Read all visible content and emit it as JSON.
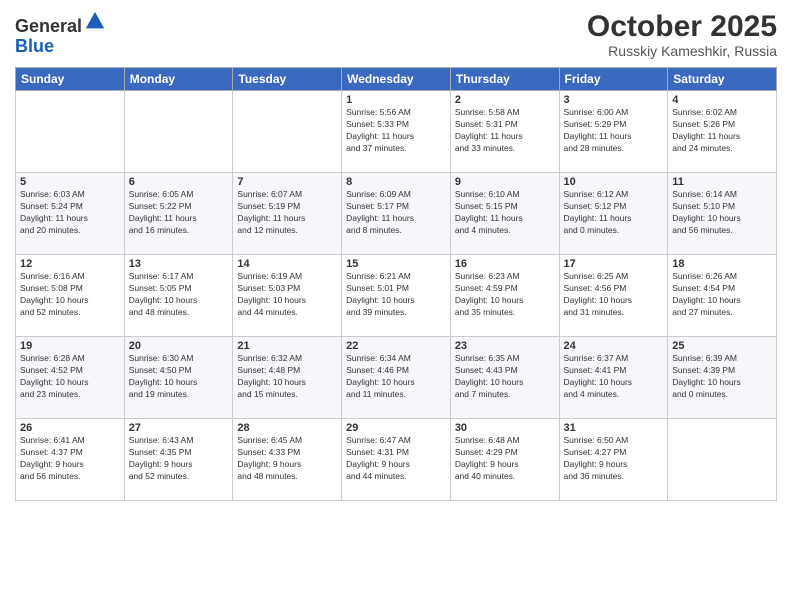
{
  "header": {
    "logo_general": "General",
    "logo_blue": "Blue",
    "month": "October 2025",
    "location": "Russkiy Kameshkir, Russia"
  },
  "weekdays": [
    "Sunday",
    "Monday",
    "Tuesday",
    "Wednesday",
    "Thursday",
    "Friday",
    "Saturday"
  ],
  "weeks": [
    [
      {
        "day": "",
        "info": ""
      },
      {
        "day": "",
        "info": ""
      },
      {
        "day": "",
        "info": ""
      },
      {
        "day": "1",
        "info": "Sunrise: 5:56 AM\nSunset: 5:33 PM\nDaylight: 11 hours\nand 37 minutes."
      },
      {
        "day": "2",
        "info": "Sunrise: 5:58 AM\nSunset: 5:31 PM\nDaylight: 11 hours\nand 33 minutes."
      },
      {
        "day": "3",
        "info": "Sunrise: 6:00 AM\nSunset: 5:29 PM\nDaylight: 11 hours\nand 28 minutes."
      },
      {
        "day": "4",
        "info": "Sunrise: 6:02 AM\nSunset: 5:26 PM\nDaylight: 11 hours\nand 24 minutes."
      }
    ],
    [
      {
        "day": "5",
        "info": "Sunrise: 6:03 AM\nSunset: 5:24 PM\nDaylight: 11 hours\nand 20 minutes."
      },
      {
        "day": "6",
        "info": "Sunrise: 6:05 AM\nSunset: 5:22 PM\nDaylight: 11 hours\nand 16 minutes."
      },
      {
        "day": "7",
        "info": "Sunrise: 6:07 AM\nSunset: 5:19 PM\nDaylight: 11 hours\nand 12 minutes."
      },
      {
        "day": "8",
        "info": "Sunrise: 6:09 AM\nSunset: 5:17 PM\nDaylight: 11 hours\nand 8 minutes."
      },
      {
        "day": "9",
        "info": "Sunrise: 6:10 AM\nSunset: 5:15 PM\nDaylight: 11 hours\nand 4 minutes."
      },
      {
        "day": "10",
        "info": "Sunrise: 6:12 AM\nSunset: 5:12 PM\nDaylight: 11 hours\nand 0 minutes."
      },
      {
        "day": "11",
        "info": "Sunrise: 6:14 AM\nSunset: 5:10 PM\nDaylight: 10 hours\nand 56 minutes."
      }
    ],
    [
      {
        "day": "12",
        "info": "Sunrise: 6:16 AM\nSunset: 5:08 PM\nDaylight: 10 hours\nand 52 minutes."
      },
      {
        "day": "13",
        "info": "Sunrise: 6:17 AM\nSunset: 5:05 PM\nDaylight: 10 hours\nand 48 minutes."
      },
      {
        "day": "14",
        "info": "Sunrise: 6:19 AM\nSunset: 5:03 PM\nDaylight: 10 hours\nand 44 minutes."
      },
      {
        "day": "15",
        "info": "Sunrise: 6:21 AM\nSunset: 5:01 PM\nDaylight: 10 hours\nand 39 minutes."
      },
      {
        "day": "16",
        "info": "Sunrise: 6:23 AM\nSunset: 4:59 PM\nDaylight: 10 hours\nand 35 minutes."
      },
      {
        "day": "17",
        "info": "Sunrise: 6:25 AM\nSunset: 4:56 PM\nDaylight: 10 hours\nand 31 minutes."
      },
      {
        "day": "18",
        "info": "Sunrise: 6:26 AM\nSunset: 4:54 PM\nDaylight: 10 hours\nand 27 minutes."
      }
    ],
    [
      {
        "day": "19",
        "info": "Sunrise: 6:28 AM\nSunset: 4:52 PM\nDaylight: 10 hours\nand 23 minutes."
      },
      {
        "day": "20",
        "info": "Sunrise: 6:30 AM\nSunset: 4:50 PM\nDaylight: 10 hours\nand 19 minutes."
      },
      {
        "day": "21",
        "info": "Sunrise: 6:32 AM\nSunset: 4:48 PM\nDaylight: 10 hours\nand 15 minutes."
      },
      {
        "day": "22",
        "info": "Sunrise: 6:34 AM\nSunset: 4:46 PM\nDaylight: 10 hours\nand 11 minutes."
      },
      {
        "day": "23",
        "info": "Sunrise: 6:35 AM\nSunset: 4:43 PM\nDaylight: 10 hours\nand 7 minutes."
      },
      {
        "day": "24",
        "info": "Sunrise: 6:37 AM\nSunset: 4:41 PM\nDaylight: 10 hours\nand 4 minutes."
      },
      {
        "day": "25",
        "info": "Sunrise: 6:39 AM\nSunset: 4:39 PM\nDaylight: 10 hours\nand 0 minutes."
      }
    ],
    [
      {
        "day": "26",
        "info": "Sunrise: 6:41 AM\nSunset: 4:37 PM\nDaylight: 9 hours\nand 56 minutes."
      },
      {
        "day": "27",
        "info": "Sunrise: 6:43 AM\nSunset: 4:35 PM\nDaylight: 9 hours\nand 52 minutes."
      },
      {
        "day": "28",
        "info": "Sunrise: 6:45 AM\nSunset: 4:33 PM\nDaylight: 9 hours\nand 48 minutes."
      },
      {
        "day": "29",
        "info": "Sunrise: 6:47 AM\nSunset: 4:31 PM\nDaylight: 9 hours\nand 44 minutes."
      },
      {
        "day": "30",
        "info": "Sunrise: 6:48 AM\nSunset: 4:29 PM\nDaylight: 9 hours\nand 40 minutes."
      },
      {
        "day": "31",
        "info": "Sunrise: 6:50 AM\nSunset: 4:27 PM\nDaylight: 9 hours\nand 36 minutes."
      },
      {
        "day": "",
        "info": ""
      }
    ]
  ]
}
